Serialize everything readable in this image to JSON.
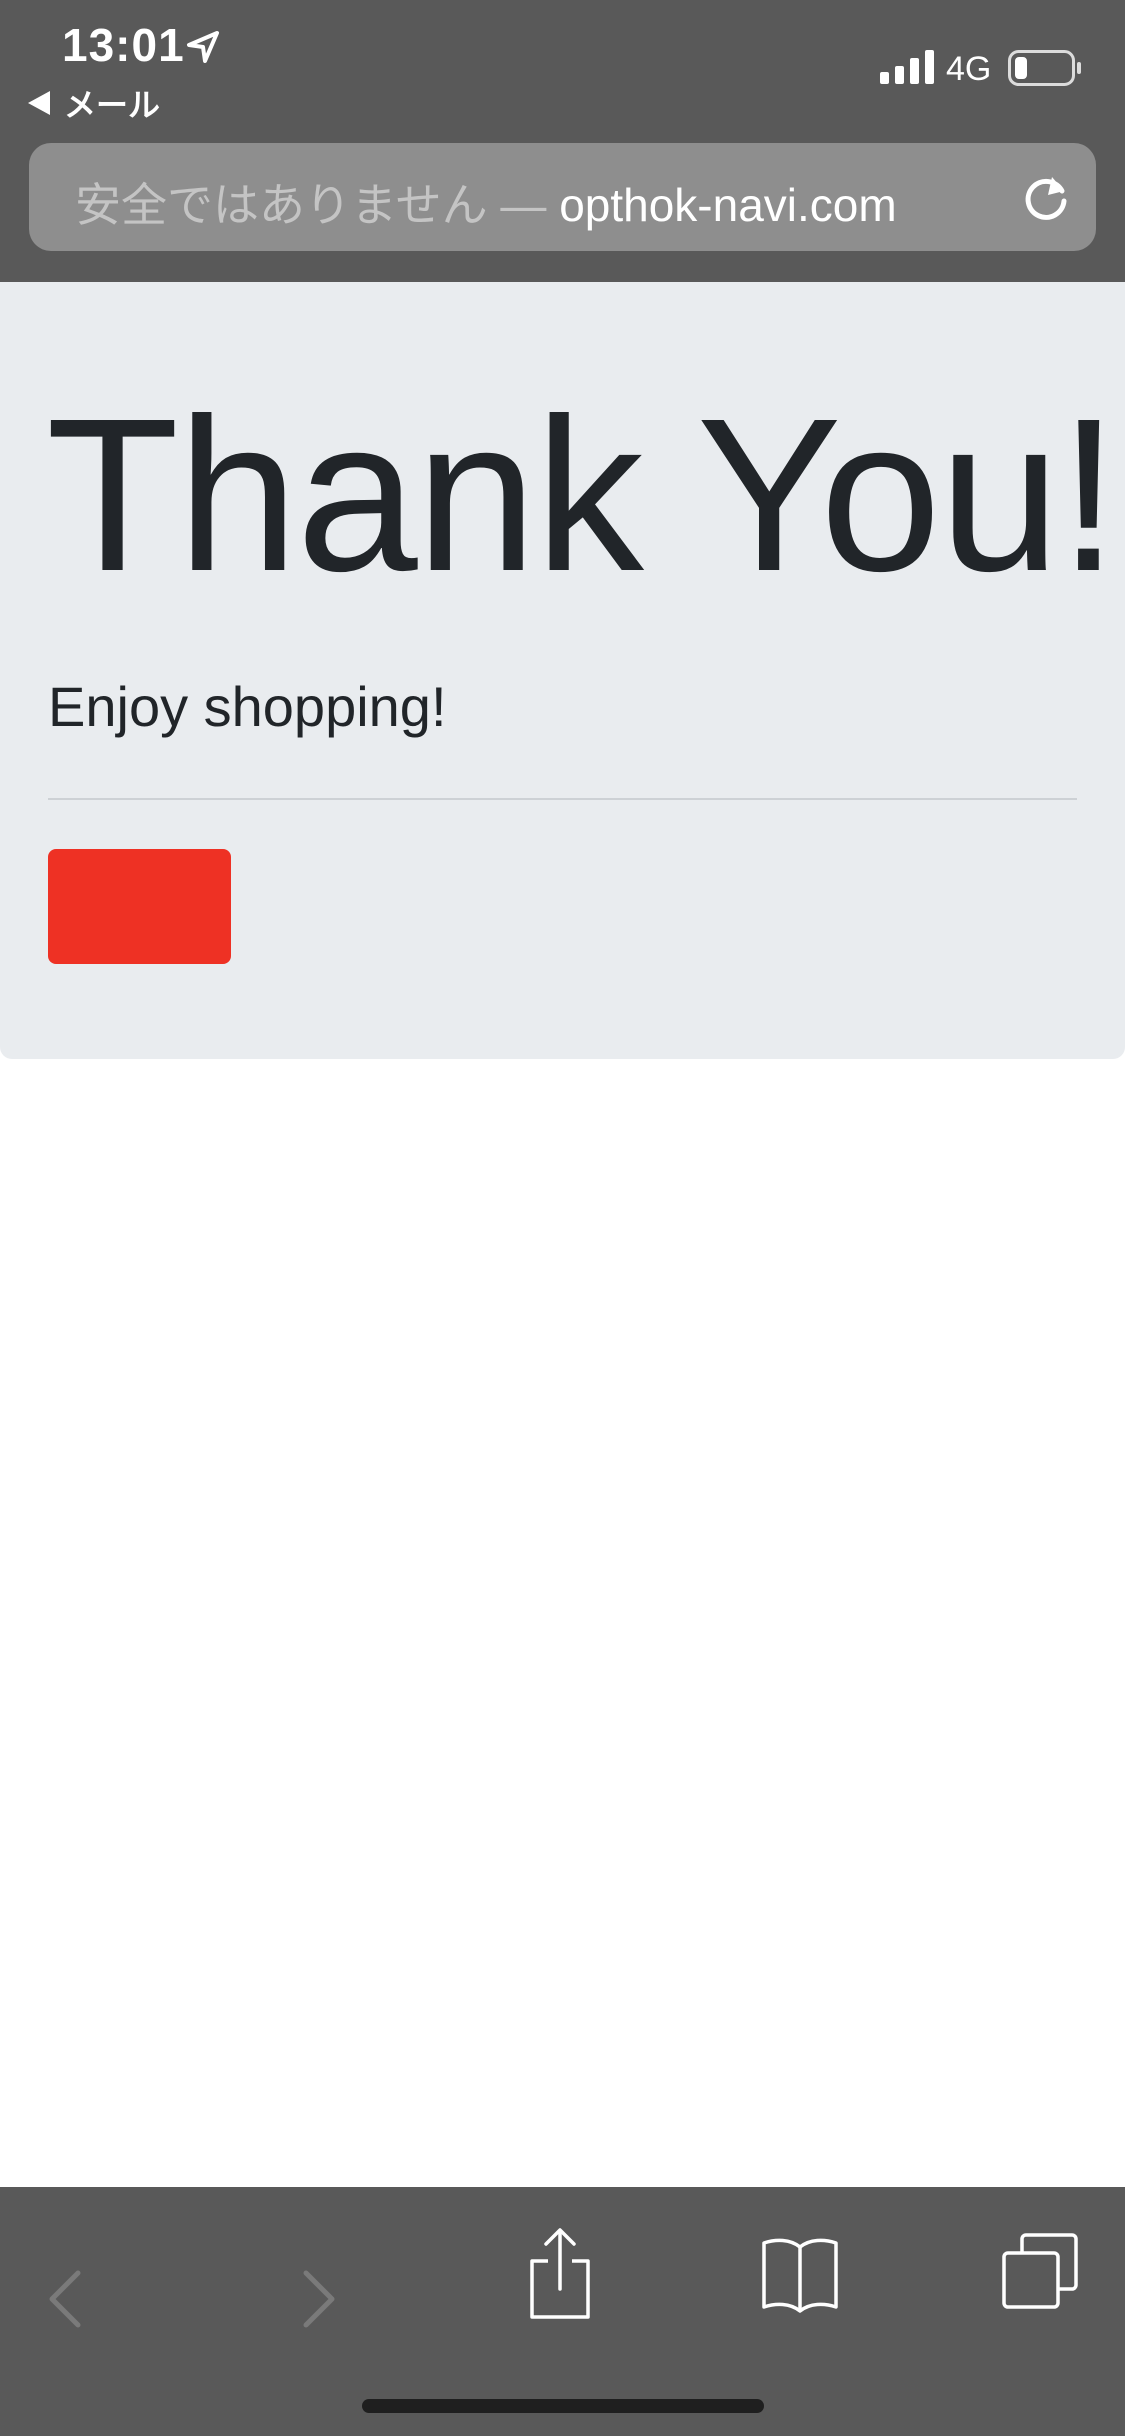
{
  "status_bar": {
    "time": "13:01",
    "back_app": "メール",
    "network": "4G"
  },
  "url_bar": {
    "insecure_label": "安全ではありません —",
    "domain": "opthok-navi.com"
  },
  "page": {
    "title": "Thank You!",
    "lead": "Enjoy shopping!",
    "button_color": "#ee3124"
  },
  "colors": {
    "chrome": "#595959",
    "jumbotron": "#e9ecef"
  },
  "icons": {
    "status": [
      "location-arrow-icon",
      "signal-icon",
      "battery-icon"
    ],
    "toolbar": [
      "back-icon",
      "forward-icon",
      "share-icon",
      "bookmarks-icon",
      "tabs-icon"
    ]
  }
}
